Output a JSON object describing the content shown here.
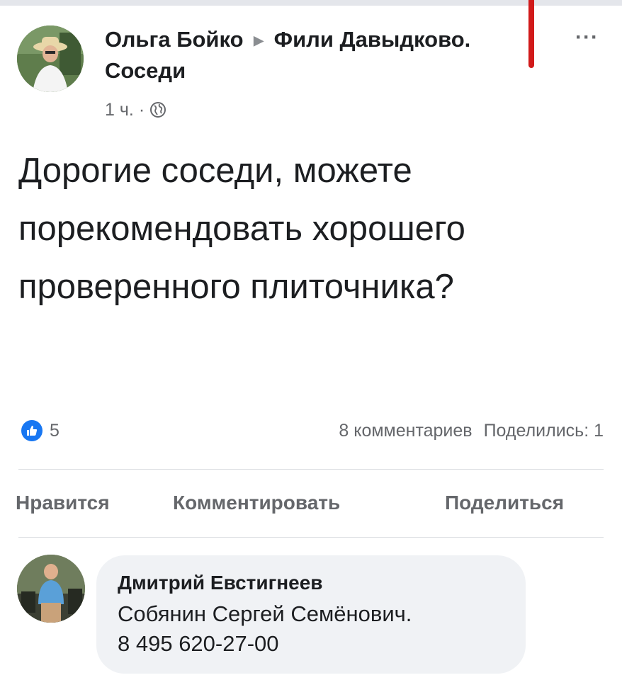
{
  "post": {
    "author": "Ольга Бойко",
    "group": "Фили Давыдково. Соседи",
    "time": "1 ч.",
    "separator": "·",
    "privacy_icon": "globe-icon",
    "text": "Дорогие соседи, можете порекомендовать хорошего проверенного плиточника?",
    "reactions_count": "5",
    "comments_count": "8 комментариев",
    "shares": "Поделились: 1",
    "more_icon": "more-dots-icon",
    "more_glyph": "···"
  },
  "actions": {
    "like": "Нравится",
    "comment": "Комментировать",
    "share": "Поделиться"
  },
  "comment": {
    "author": "Дмитрий Евстигнеев",
    "text_line1": "Собянин Сергей Семёнович.",
    "text_line2": "8 495 620-27-00"
  },
  "colors": {
    "like_blue": "#1877f2",
    "marker_red": "#d11a1a",
    "bubble_bg": "#f0f2f5",
    "secondary_text": "#65676b"
  }
}
